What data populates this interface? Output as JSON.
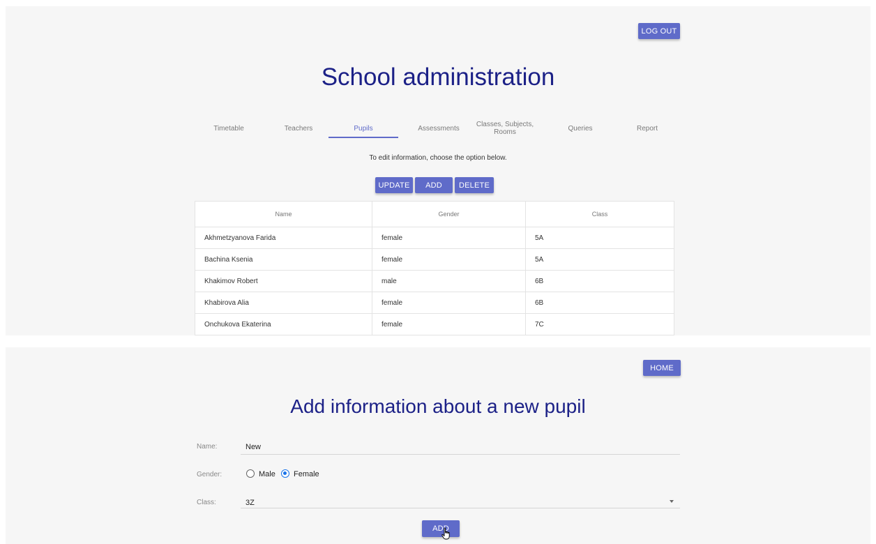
{
  "admin_page": {
    "logout_label": "LOG OUT",
    "title": "School administration",
    "tabs": [
      {
        "label": "Timetable"
      },
      {
        "label": "Teachers"
      },
      {
        "label": "Pupils",
        "active": true
      },
      {
        "label": "Assessments"
      },
      {
        "label": "Classes, Subjects, Rooms"
      },
      {
        "label": "Queries"
      },
      {
        "label": "Report"
      }
    ],
    "instruction": "To edit information, choose the option below.",
    "actions": {
      "update": "UPDATE",
      "add": "ADD",
      "delete": "DELETE"
    },
    "table": {
      "headers": [
        "Name",
        "Gender",
        "Class"
      ],
      "rows": [
        [
          "Akhmetzyanova Farida",
          "female",
          "5A"
        ],
        [
          "Bachina Ksenia",
          "female",
          "5A"
        ],
        [
          "Khakimov Robert",
          "male",
          "6B"
        ],
        [
          "Khabirova Alia",
          "female",
          "6B"
        ],
        [
          "Onchukova Ekaterina",
          "female",
          "7C"
        ]
      ]
    }
  },
  "add_page": {
    "home_label": "HOME",
    "title": "Add information about a new pupil",
    "name_label": "Name:",
    "name_value": "New",
    "gender_label": "Gender:",
    "gender_options": [
      "Male",
      "Female"
    ],
    "gender_selected": "Female",
    "class_label": "Class:",
    "class_value": "3Z",
    "submit_label": "ADD"
  },
  "colors": {
    "accent": "#5f6bc9",
    "title": "#1c2187",
    "panel_bg": "#f6f6f6",
    "radio_selected": "#1a73e8"
  },
  "icons": [
    "dropdown-arrow-icon",
    "hand-cursor-icon"
  ]
}
